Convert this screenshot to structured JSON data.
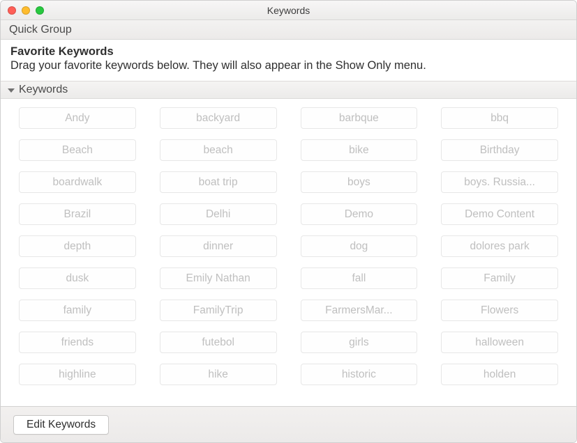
{
  "window": {
    "title": "Keywords"
  },
  "quick_group": {
    "label": "Quick Group"
  },
  "favorites": {
    "title": "Favorite Keywords",
    "description": "Drag your favorite keywords below. They will also appear in the Show Only menu."
  },
  "section": {
    "label": "Keywords"
  },
  "keywords": [
    "Andy",
    "backyard",
    "barbque",
    "bbq",
    "Beach",
    "beach",
    "bike",
    "Birthday",
    "boardwalk",
    "boat trip",
    "boys",
    "boys. Russia...",
    "Brazil",
    "Delhi",
    "Demo",
    "Demo Content",
    "depth",
    "dinner",
    "dog",
    "dolores park",
    "dusk",
    "Emily Nathan",
    "fall",
    "Family",
    "family",
    "FamilyTrip",
    "FarmersMar...",
    "Flowers",
    "friends",
    "futebol",
    "girls",
    "halloween",
    "highline",
    "hike",
    "historic",
    "holden"
  ],
  "footer": {
    "edit_button": "Edit Keywords"
  }
}
